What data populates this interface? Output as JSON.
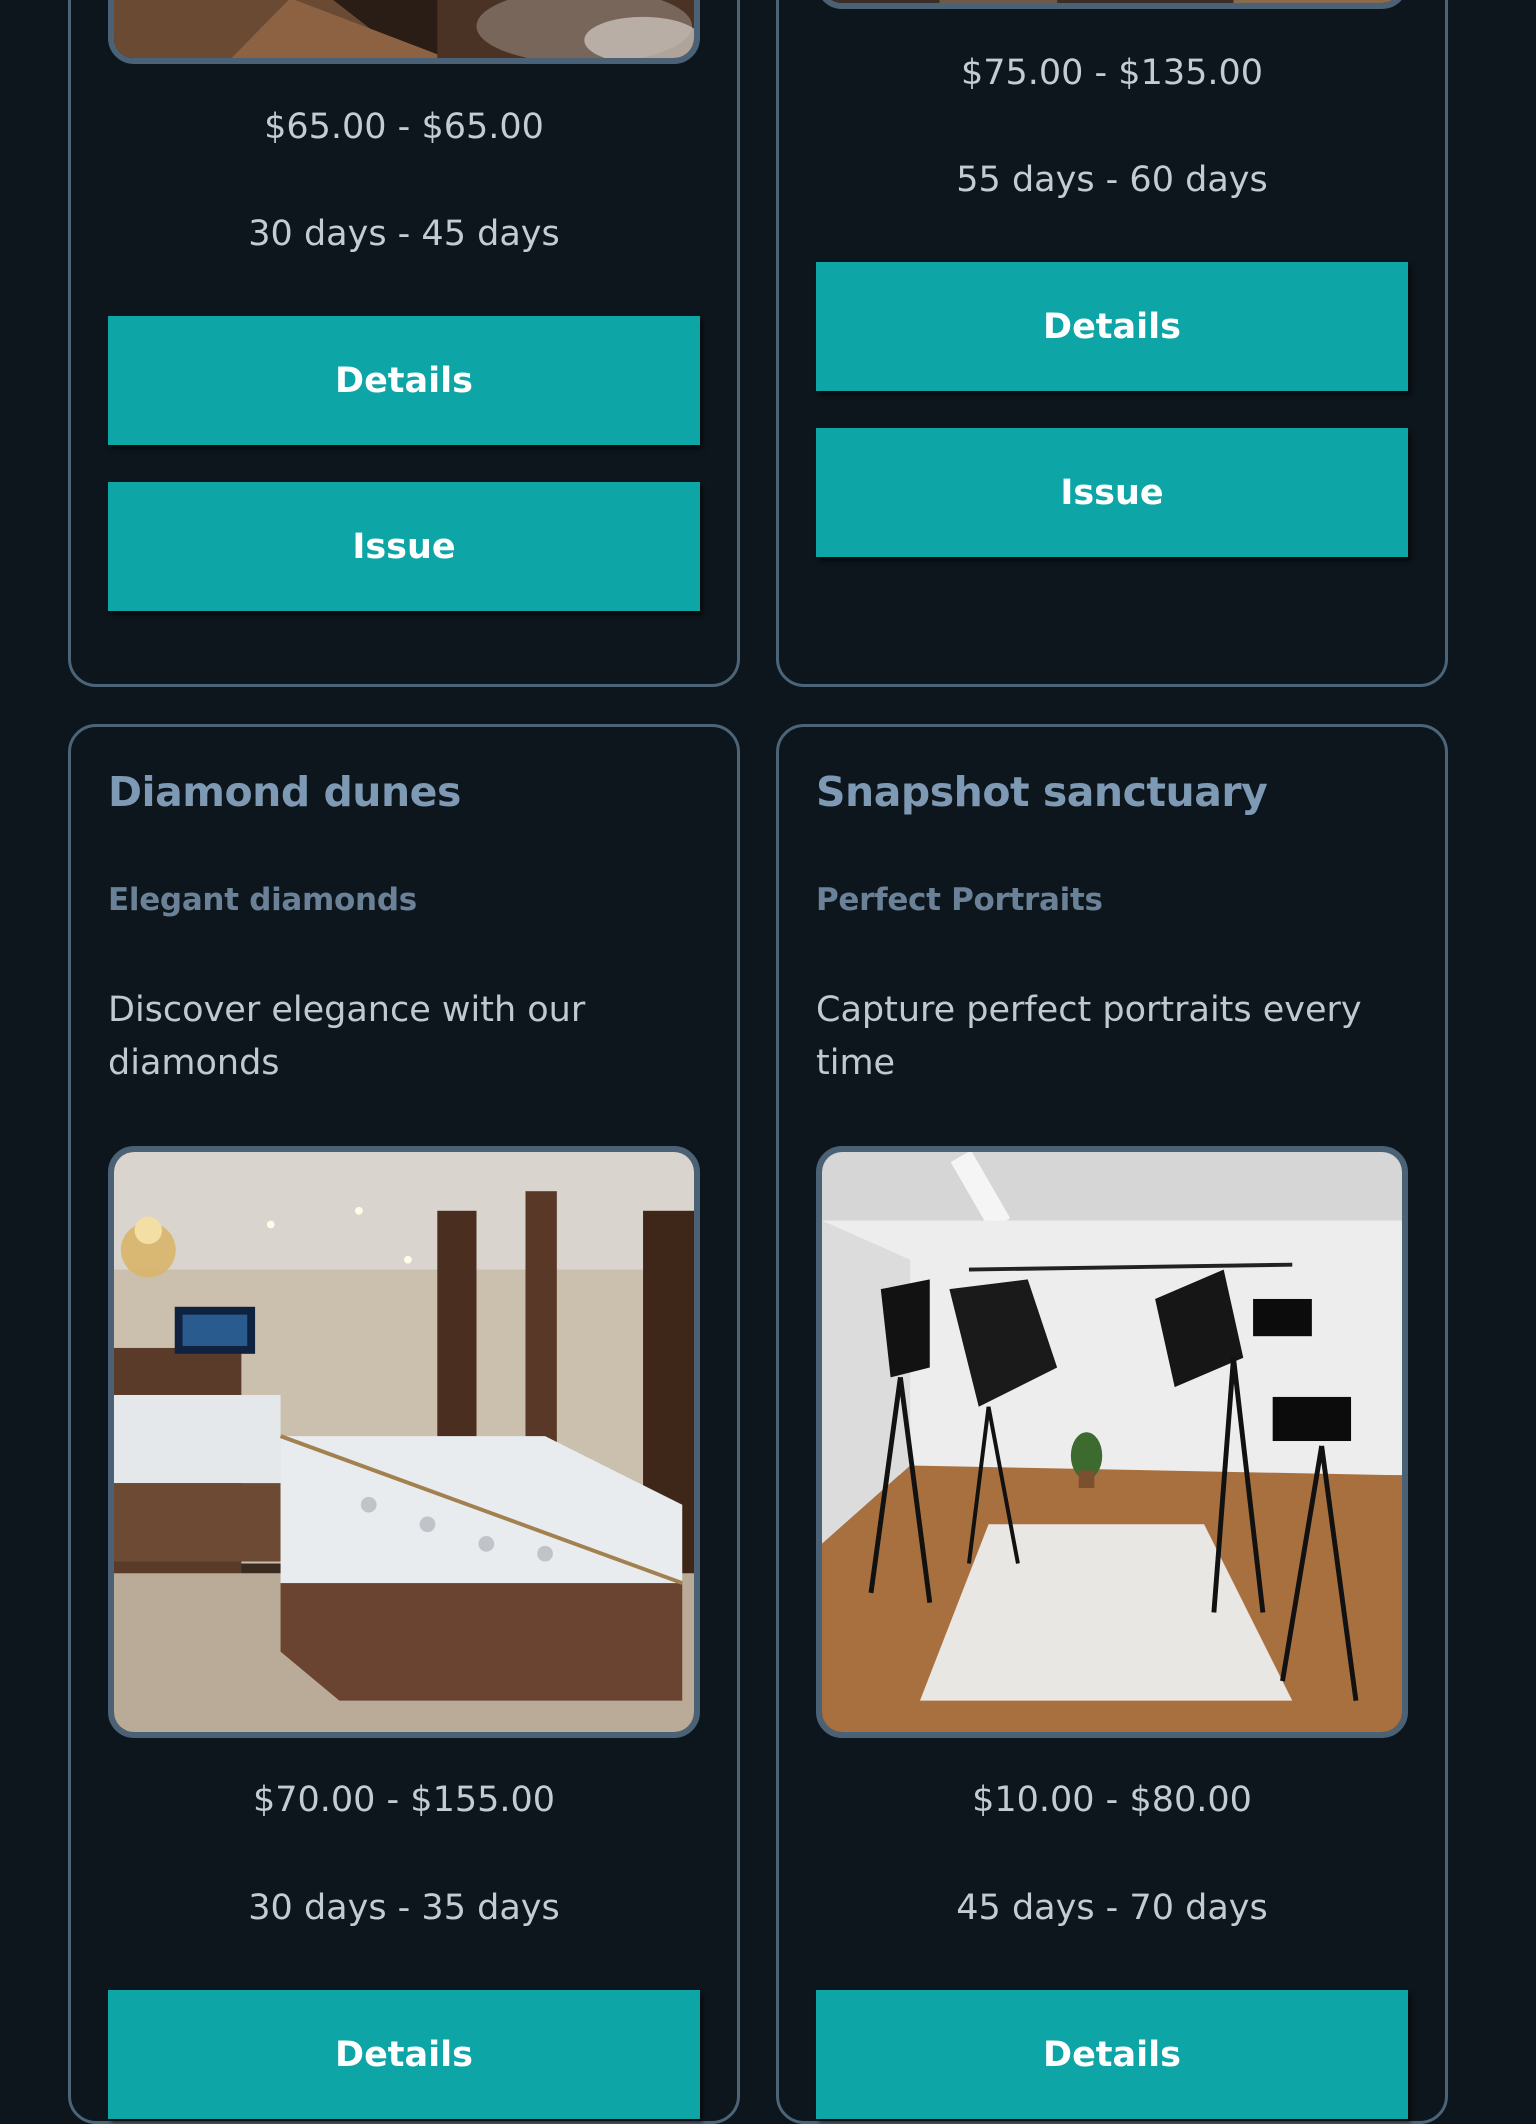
{
  "cards": [
    {
      "price": "$65.00 - $65.00",
      "duration": "30 days - 45 days",
      "details_label": "Details",
      "issue_label": "Issue"
    },
    {
      "price": "$75.00 - $135.00",
      "duration": "55 days - 60 days",
      "details_label": "Details",
      "issue_label": "Issue"
    },
    {
      "title": "Diamond dunes",
      "subtitle": "Elegant diamonds",
      "description": "Discover elegance with our diamonds",
      "image": "jewelry-store-photo",
      "price": "$70.00 - $155.00",
      "duration": "30 days - 35 days",
      "details_label": "Details"
    },
    {
      "title": "Snapshot sanctuary",
      "subtitle": "Perfect Portraits",
      "description": "Capture perfect portraits every time",
      "image": "photo-studio-photo",
      "price": "$10.00 - $80.00",
      "duration": "45 days - 70 days",
      "details_label": "Details"
    }
  ],
  "colors": {
    "background": "#0d161d",
    "card_border": "#4c6478",
    "button": "#0ea5a7",
    "title": "#7d99b3",
    "subtitle": "#6a8197"
  }
}
